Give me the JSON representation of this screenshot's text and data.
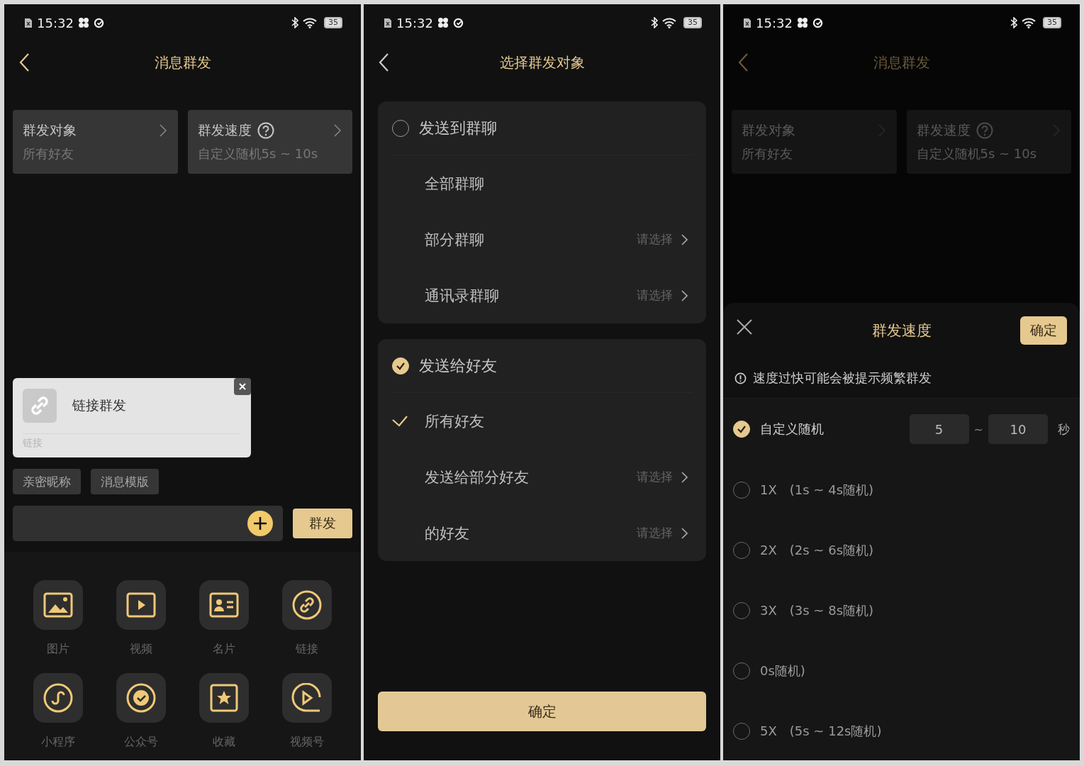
{
  "screens": [
    {
      "kind": "compose",
      "status_bar": {
        "time": "15:32",
        "battery": "35"
      },
      "title": "消息群发",
      "settings_cards": [
        {
          "label": "群发对象",
          "value": "所有好友",
          "help": false
        },
        {
          "label": "群发速度",
          "value": "自定义随机5s ~ 10s",
          "help": true
        }
      ],
      "link_card": {
        "title": "链接群发",
        "caption": "链接"
      },
      "chips": [
        "亲密昵称",
        "消息模版"
      ],
      "send_button": "群发",
      "attachments": [
        {
          "label": "图片",
          "kind": "image"
        },
        {
          "label": "视频",
          "kind": "video"
        },
        {
          "label": "名片",
          "kind": "contact"
        },
        {
          "label": "链接",
          "kind": "link"
        },
        {
          "label": "小程序",
          "kind": "miniprogram"
        },
        {
          "label": "公众号",
          "kind": "badge"
        },
        {
          "label": "收藏",
          "kind": "star"
        },
        {
          "label": "视频号",
          "kind": "channel"
        }
      ]
    },
    {
      "kind": "target",
      "status_bar": {
        "time": "15:32",
        "battery": "35"
      },
      "title": "选择群发对象",
      "groups": [
        {
          "label": "发送到群聊",
          "selected": false,
          "options": [
            {
              "label": "全部群聊",
              "selected": false
            },
            {
              "label": "部分群聊",
              "action": "请选择",
              "selected": false
            },
            {
              "label": "通讯录群聊",
              "action": "请选择",
              "selected": false
            }
          ]
        },
        {
          "label": "发送给好友",
          "selected": true,
          "options": [
            {
              "label": "所有好友",
              "selected": true
            },
            {
              "label": "发送给部分好友",
              "action": "请选择",
              "selected": false
            },
            {
              "label": "的好友",
              "action": "请选择",
              "selected": false
            }
          ]
        }
      ],
      "confirm": "确定"
    },
    {
      "kind": "speed",
      "status_bar": {
        "time": "15:32",
        "battery": "35"
      },
      "title": "消息群发",
      "settings_cards": [
        {
          "label": "群发对象",
          "value": "所有好友",
          "help": false
        },
        {
          "label": "群发速度",
          "value": "自定义随机5s ~ 10s",
          "help": true
        }
      ],
      "sheet": {
        "title": "群发速度",
        "confirm": "确定",
        "warning": "速度过快可能会被提示频繁群发",
        "options": [
          {
            "kind": "custom",
            "label": "自定义随机",
            "selected": true,
            "min": "5",
            "separator": "~",
            "max": "10",
            "unit": "秒"
          },
          {
            "kind": "preset",
            "label": "1X",
            "range": "(1s ~ 4s随机)",
            "selected": false
          },
          {
            "kind": "preset",
            "label": "2X",
            "range": "(2s ~ 6s随机)",
            "selected": false
          },
          {
            "kind": "preset",
            "label": "3X",
            "range": "(3s ~ 8s随机)",
            "selected": false
          },
          {
            "kind": "preset",
            "range": "0s随机)",
            "selected": false
          },
          {
            "kind": "preset",
            "label": "5X",
            "range": "(5s ~ 12s随机)",
            "selected": false
          }
        ]
      }
    }
  ]
}
